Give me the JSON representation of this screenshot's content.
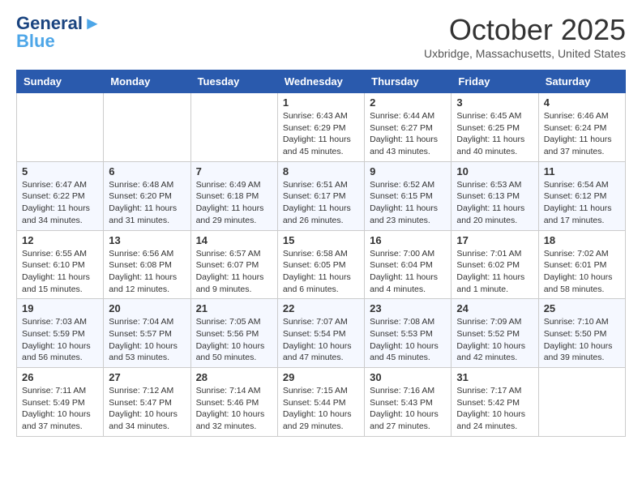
{
  "header": {
    "logo_line1": "General",
    "logo_line2": "Blue",
    "month_title": "October 2025",
    "location": "Uxbridge, Massachusetts, United States"
  },
  "weekdays": [
    "Sunday",
    "Monday",
    "Tuesday",
    "Wednesday",
    "Thursday",
    "Friday",
    "Saturday"
  ],
  "weeks": [
    [
      {
        "day": "",
        "info": ""
      },
      {
        "day": "",
        "info": ""
      },
      {
        "day": "",
        "info": ""
      },
      {
        "day": "1",
        "info": "Sunrise: 6:43 AM\nSunset: 6:29 PM\nDaylight: 11 hours\nand 45 minutes."
      },
      {
        "day": "2",
        "info": "Sunrise: 6:44 AM\nSunset: 6:27 PM\nDaylight: 11 hours\nand 43 minutes."
      },
      {
        "day": "3",
        "info": "Sunrise: 6:45 AM\nSunset: 6:25 PM\nDaylight: 11 hours\nand 40 minutes."
      },
      {
        "day": "4",
        "info": "Sunrise: 6:46 AM\nSunset: 6:24 PM\nDaylight: 11 hours\nand 37 minutes."
      }
    ],
    [
      {
        "day": "5",
        "info": "Sunrise: 6:47 AM\nSunset: 6:22 PM\nDaylight: 11 hours\nand 34 minutes."
      },
      {
        "day": "6",
        "info": "Sunrise: 6:48 AM\nSunset: 6:20 PM\nDaylight: 11 hours\nand 31 minutes."
      },
      {
        "day": "7",
        "info": "Sunrise: 6:49 AM\nSunset: 6:18 PM\nDaylight: 11 hours\nand 29 minutes."
      },
      {
        "day": "8",
        "info": "Sunrise: 6:51 AM\nSunset: 6:17 PM\nDaylight: 11 hours\nand 26 minutes."
      },
      {
        "day": "9",
        "info": "Sunrise: 6:52 AM\nSunset: 6:15 PM\nDaylight: 11 hours\nand 23 minutes."
      },
      {
        "day": "10",
        "info": "Sunrise: 6:53 AM\nSunset: 6:13 PM\nDaylight: 11 hours\nand 20 minutes."
      },
      {
        "day": "11",
        "info": "Sunrise: 6:54 AM\nSunset: 6:12 PM\nDaylight: 11 hours\nand 17 minutes."
      }
    ],
    [
      {
        "day": "12",
        "info": "Sunrise: 6:55 AM\nSunset: 6:10 PM\nDaylight: 11 hours\nand 15 minutes."
      },
      {
        "day": "13",
        "info": "Sunrise: 6:56 AM\nSunset: 6:08 PM\nDaylight: 11 hours\nand 12 minutes."
      },
      {
        "day": "14",
        "info": "Sunrise: 6:57 AM\nSunset: 6:07 PM\nDaylight: 11 hours\nand 9 minutes."
      },
      {
        "day": "15",
        "info": "Sunrise: 6:58 AM\nSunset: 6:05 PM\nDaylight: 11 hours\nand 6 minutes."
      },
      {
        "day": "16",
        "info": "Sunrise: 7:00 AM\nSunset: 6:04 PM\nDaylight: 11 hours\nand 4 minutes."
      },
      {
        "day": "17",
        "info": "Sunrise: 7:01 AM\nSunset: 6:02 PM\nDaylight: 11 hours\nand 1 minute."
      },
      {
        "day": "18",
        "info": "Sunrise: 7:02 AM\nSunset: 6:01 PM\nDaylight: 10 hours\nand 58 minutes."
      }
    ],
    [
      {
        "day": "19",
        "info": "Sunrise: 7:03 AM\nSunset: 5:59 PM\nDaylight: 10 hours\nand 56 minutes."
      },
      {
        "day": "20",
        "info": "Sunrise: 7:04 AM\nSunset: 5:57 PM\nDaylight: 10 hours\nand 53 minutes."
      },
      {
        "day": "21",
        "info": "Sunrise: 7:05 AM\nSunset: 5:56 PM\nDaylight: 10 hours\nand 50 minutes."
      },
      {
        "day": "22",
        "info": "Sunrise: 7:07 AM\nSunset: 5:54 PM\nDaylight: 10 hours\nand 47 minutes."
      },
      {
        "day": "23",
        "info": "Sunrise: 7:08 AM\nSunset: 5:53 PM\nDaylight: 10 hours\nand 45 minutes."
      },
      {
        "day": "24",
        "info": "Sunrise: 7:09 AM\nSunset: 5:52 PM\nDaylight: 10 hours\nand 42 minutes."
      },
      {
        "day": "25",
        "info": "Sunrise: 7:10 AM\nSunset: 5:50 PM\nDaylight: 10 hours\nand 39 minutes."
      }
    ],
    [
      {
        "day": "26",
        "info": "Sunrise: 7:11 AM\nSunset: 5:49 PM\nDaylight: 10 hours\nand 37 minutes."
      },
      {
        "day": "27",
        "info": "Sunrise: 7:12 AM\nSunset: 5:47 PM\nDaylight: 10 hours\nand 34 minutes."
      },
      {
        "day": "28",
        "info": "Sunrise: 7:14 AM\nSunset: 5:46 PM\nDaylight: 10 hours\nand 32 minutes."
      },
      {
        "day": "29",
        "info": "Sunrise: 7:15 AM\nSunset: 5:44 PM\nDaylight: 10 hours\nand 29 minutes."
      },
      {
        "day": "30",
        "info": "Sunrise: 7:16 AM\nSunset: 5:43 PM\nDaylight: 10 hours\nand 27 minutes."
      },
      {
        "day": "31",
        "info": "Sunrise: 7:17 AM\nSunset: 5:42 PM\nDaylight: 10 hours\nand 24 minutes."
      },
      {
        "day": "",
        "info": ""
      }
    ]
  ]
}
